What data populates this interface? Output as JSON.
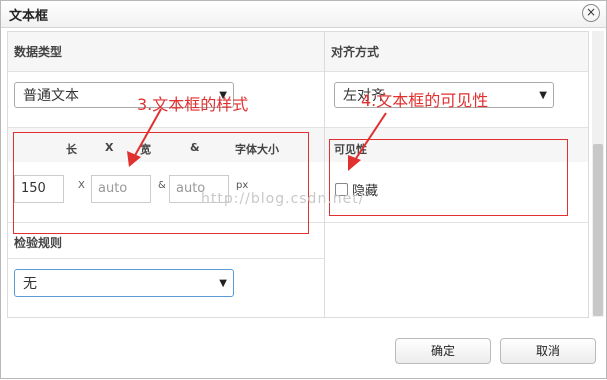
{
  "dialog": {
    "title": "文本框",
    "close_glyph": "×"
  },
  "sections": {
    "data_type": {
      "header": "数据类型",
      "select_value": "普通文本"
    },
    "alignment": {
      "header": "对齐方式",
      "select_value": "左对齐"
    },
    "style": {
      "col_length": "长",
      "sep1": "X",
      "col_width": "宽",
      "sep2": "&",
      "col_font_size": "字体大小",
      "length_value": "150",
      "x_label": "X",
      "width_placeholder": "auto",
      "amp_label": "&",
      "font_placeholder": "auto",
      "unit": "px"
    },
    "visibility": {
      "header": "可见性",
      "checkbox_label": "隐藏",
      "checked": false
    },
    "validation": {
      "header": "检验规则",
      "select_value": "无"
    }
  },
  "annotations": {
    "style_note": "3.文本框的样式",
    "visibility_note": "4.文本框的可见性",
    "color": "#e03030"
  },
  "watermark": "http://blog.csdn.net/",
  "footer": {
    "ok_label": "确定",
    "cancel_label": "取消"
  },
  "icons": {
    "close": "close-icon",
    "dropdown": "chevron-down-icon",
    "arrow": "arrow-annotation-icon"
  }
}
